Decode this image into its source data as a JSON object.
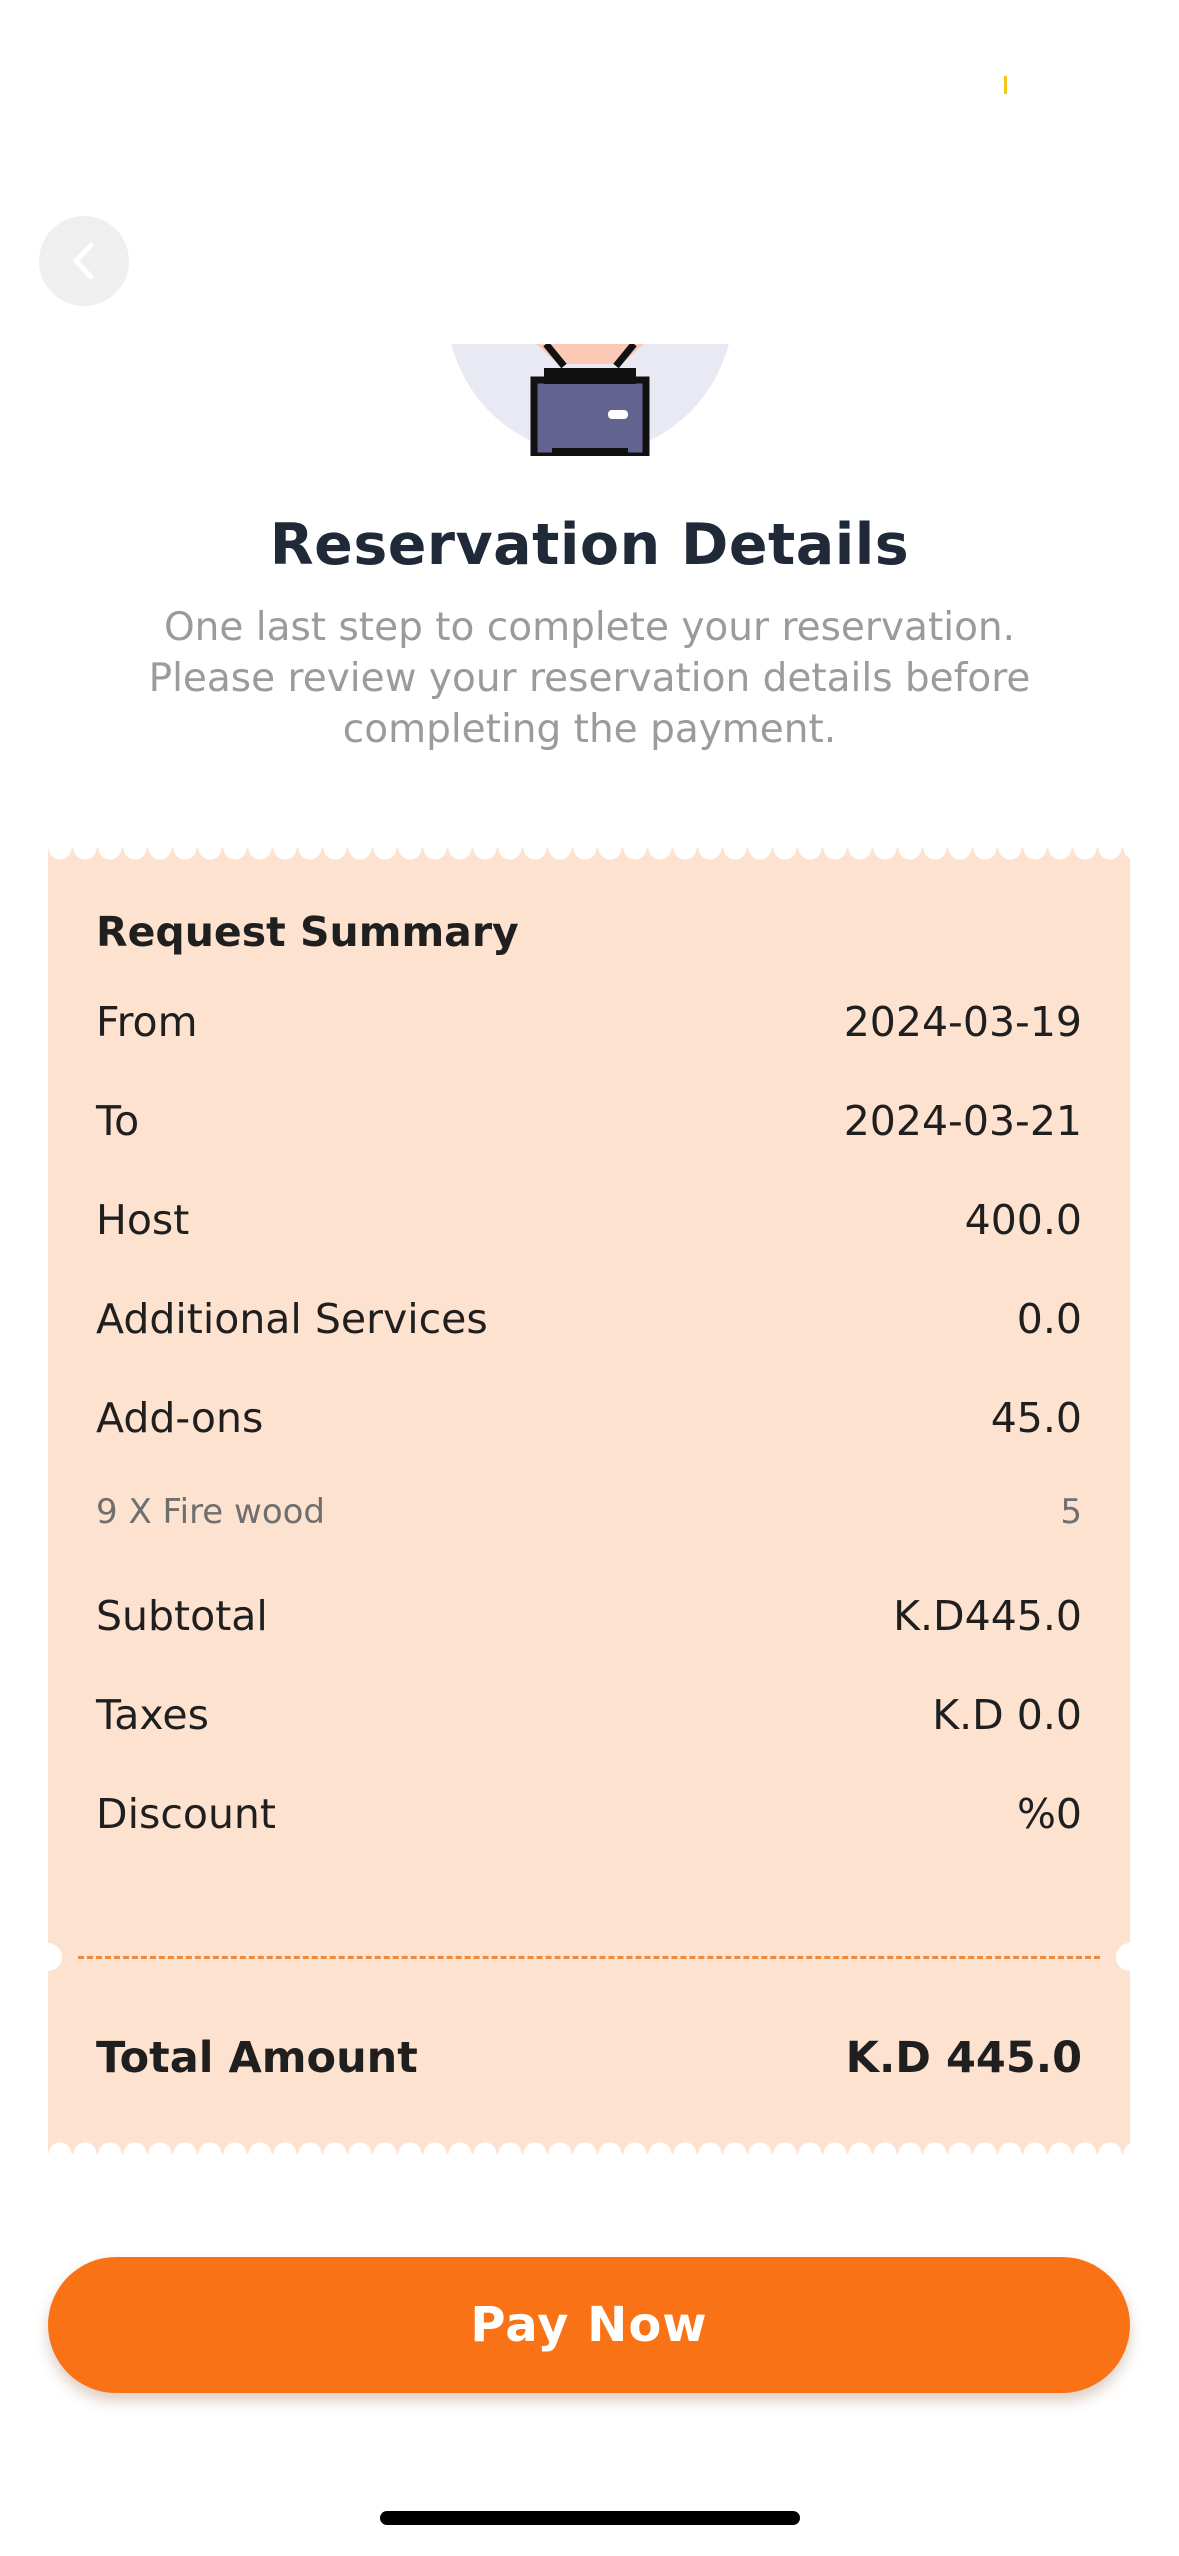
{
  "header": {
    "back_icon": "chevron-left-icon"
  },
  "hero": {
    "icon": "hand-holding-card-icon"
  },
  "title": "Reservation Details",
  "subtitle_lines": [
    "One last step to complete your reservation.",
    "Please review your reservation details before",
    "completing the payment."
  ],
  "summary": {
    "heading": "Request Summary",
    "rows": [
      {
        "label": "From",
        "value": "2024-03-19"
      },
      {
        "label": "To",
        "value": "2024-03-21"
      },
      {
        "label": "Host",
        "value": "400.0"
      },
      {
        "label": "Additional Services",
        "value": "0.0"
      },
      {
        "label": "Add-ons",
        "value": "45.0"
      }
    ],
    "addon_items": [
      {
        "label": "9 X Fire wood",
        "value": "5"
      }
    ],
    "totals": [
      {
        "label": "Subtotal",
        "value": "K.D445.0"
      },
      {
        "label": "Taxes",
        "value": "K.D 0.0"
      },
      {
        "label": "Discount",
        "value": "%0"
      }
    ],
    "total": {
      "label": "Total Amount",
      "value": "K.D 445.0"
    }
  },
  "pay_button": "Pay Now",
  "colors": {
    "accent": "#f97316",
    "receipt_bg": "#fde2d0",
    "title": "#1f2937",
    "subtitle": "#9b9b9b"
  }
}
